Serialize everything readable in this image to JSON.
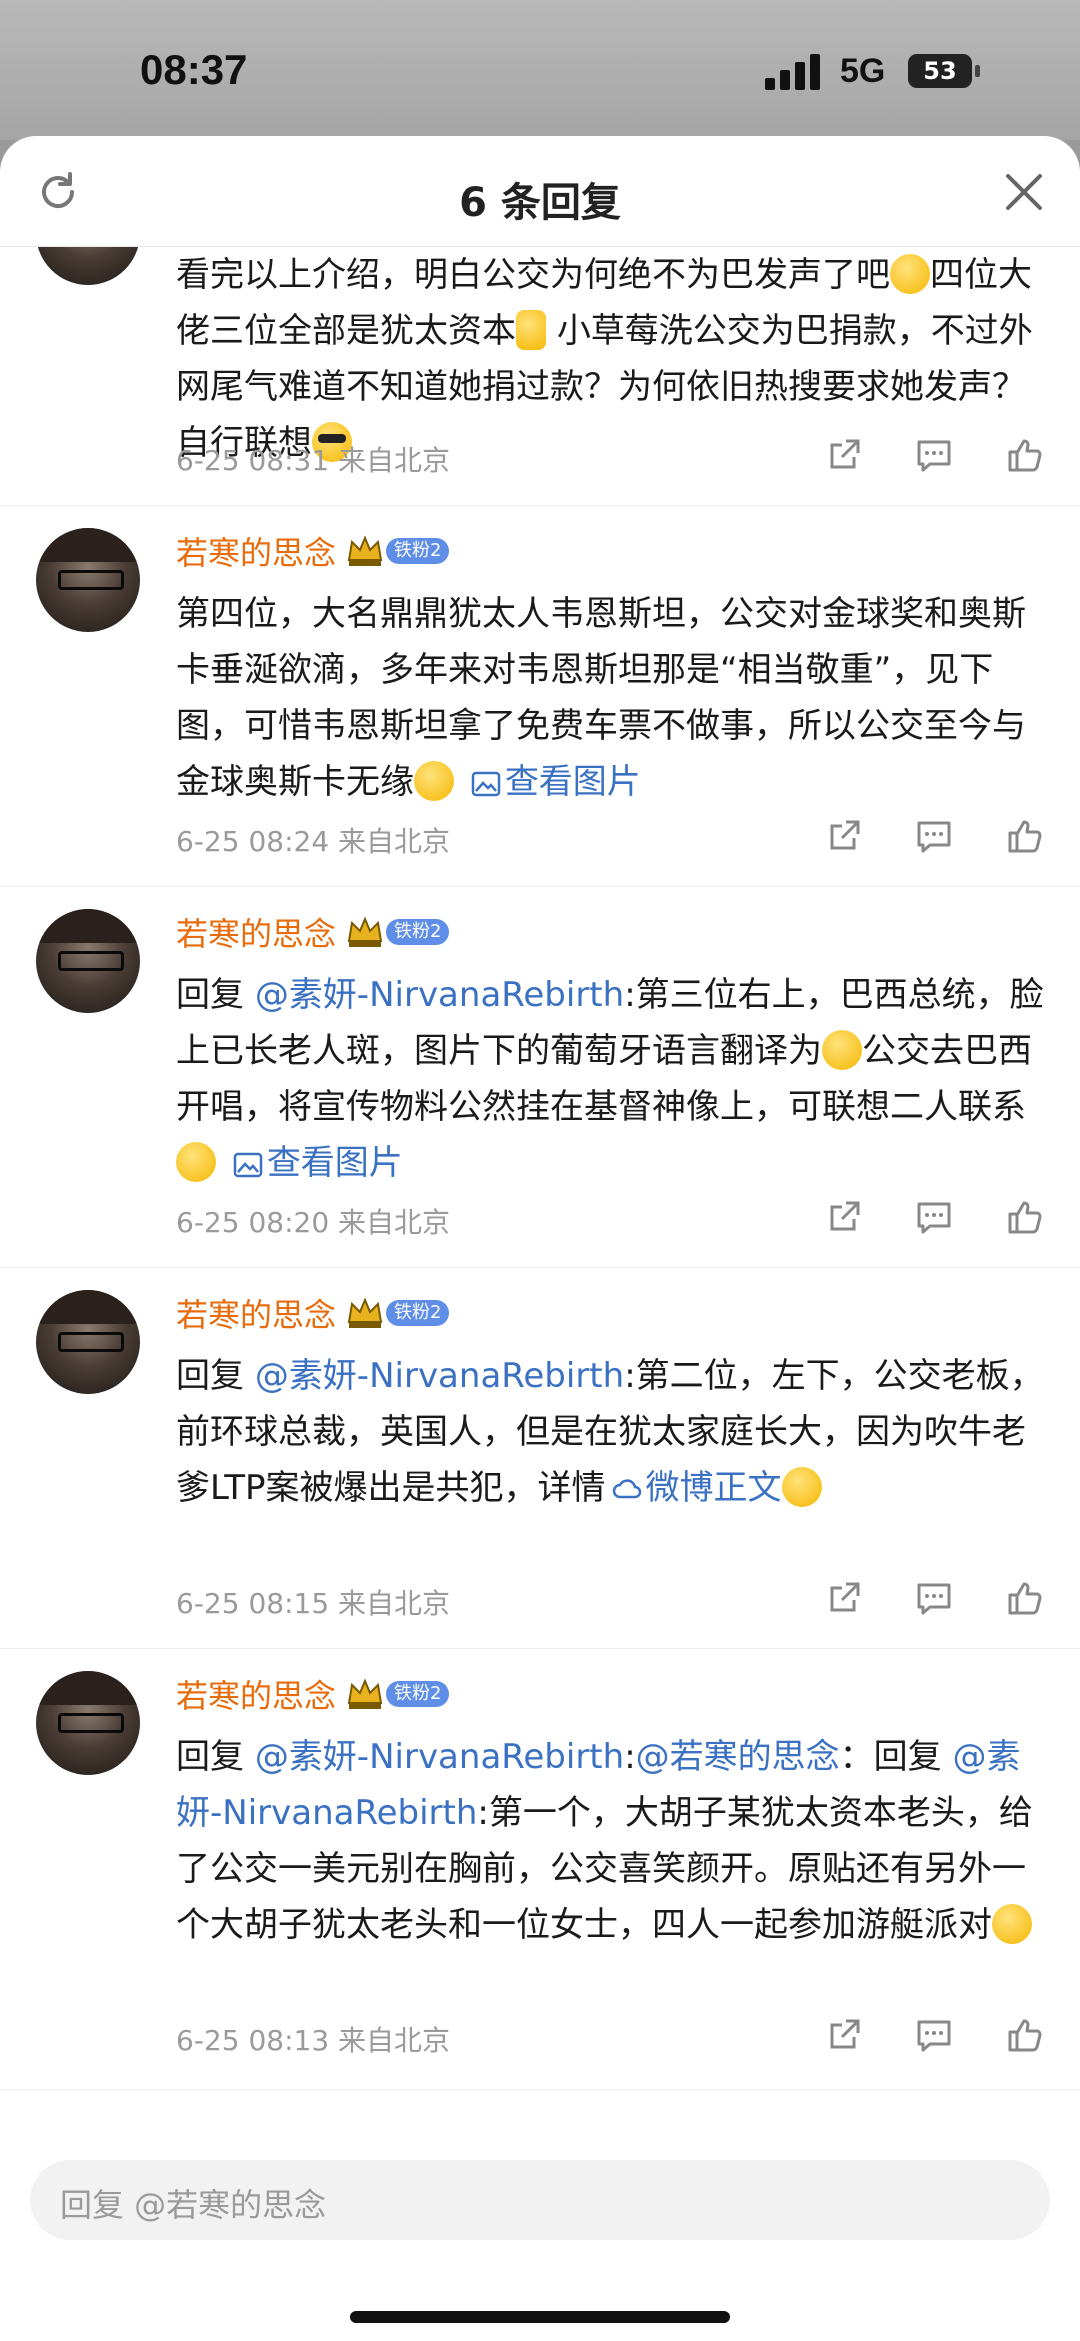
{
  "status_bar": {
    "time": "08:37",
    "network": "5G",
    "battery": "53"
  },
  "header": {
    "title": "6 条回复"
  },
  "comments": [
    {
      "body_parts": [
        "看完以上介绍，明白公交为何绝不为巴发声了吧",
        "四位大佬三位全部是犹太资本",
        "小草莓洗公交为巴捐款，不过外网尾气难道不知道她捐过款？为何依旧热搜要求她发声？自行联想"
      ],
      "time": "6-25 08:31",
      "location": "来自北京"
    },
    {
      "username": "若寒的思念",
      "badge": "铁粉2",
      "body_parts": [
        "第四位，大名鼎鼎犹太人韦恩斯坦，公交对金球奖和奥斯卡垂涎欲滴，多年来对韦恩斯坦那是“相当敬重”，见下图，可惜韦恩斯坦拿了免费车票不做事，所以公交至今与金球奥斯卡无缘"
      ],
      "link": "查看图片",
      "time": "6-25 08:24",
      "location": "来自北京"
    },
    {
      "username": "若寒的思念",
      "badge": "铁粉2",
      "reply_prefix": "回复",
      "mention": "@素妍-NirvanaRebirth",
      "body_parts": [
        ":第三位右上，巴西总统，脸上已长老人斑，图片下的葡萄牙语言翻译为",
        "公交去巴西开唱，将宣传物料公然挂在基督神像上，可联想二人联系"
      ],
      "link": "查看图片",
      "time": "6-25 08:20",
      "location": "来自北京"
    },
    {
      "username": "若寒的思念",
      "badge": "铁粉2",
      "reply_prefix": "回复",
      "mention": "@素妍-NirvanaRebirth",
      "body_parts": [
        ":第二位，左下，公交老板，前环球总裁，英国人，但是在犹太家庭长大，因为吹牛老爹LTP案被爆出是共犯，详情"
      ],
      "link": "微博正文",
      "time": "6-25 08:15",
      "location": "来自北京"
    },
    {
      "username": "若寒的思念",
      "badge": "铁粉2",
      "reply_prefix": "回复",
      "mention": "@素妍-NirvanaRebirth",
      "mention2": "@若寒的思念",
      "reply_mid": "：回复",
      "mention3": "@素妍-NirvanaRebirth",
      "body_parts": [
        ":第一个，大胡子某犹太资本老头，给了公交一美元别在胸前，公交喜笑颜开。原贴还有另外一个大胡子犹太老头和一位女士，四人一起参加游艇派对"
      ],
      "time": "6-25 08:13",
      "location": "来自北京"
    }
  ],
  "reply_input": {
    "placeholder": "回复 @若寒的思念"
  },
  "colors": {
    "username": "#e86b0c",
    "link": "#3b71c2",
    "badge": "#5f8ee8",
    "meta": "#9a9a9a"
  },
  "icons": [
    "refresh-icon",
    "close-icon",
    "share-icon",
    "comment-icon",
    "like-icon",
    "crown-icon",
    "image-icon",
    "cloud-icon"
  ]
}
